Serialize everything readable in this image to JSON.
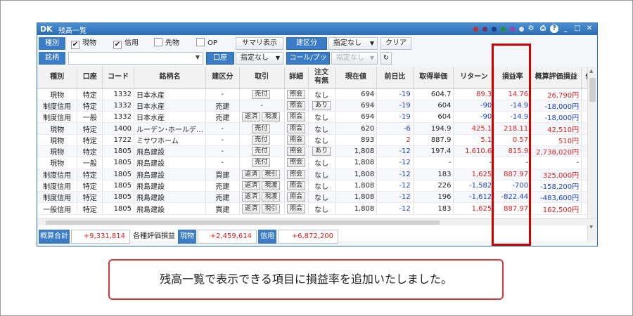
{
  "window": {
    "title": "残高一覧",
    "logo": "DK"
  },
  "colors": {
    "accent": "#3a7cc6",
    "positive": "#e02020",
    "negative": "#1a3fd6",
    "highlight": "#d10000",
    "dots": [
      "#c03030",
      "#7a2c6e",
      "#1f3f8c",
      "#2d8c3a",
      "#9a44aa",
      "#e0e0e0"
    ]
  },
  "toolbar1": {
    "label": "種別",
    "checks": [
      {
        "label": "現物",
        "checked": "✔"
      },
      {
        "label": "信用",
        "checked": "✔"
      },
      {
        "label": "先物",
        "checked": ""
      },
      {
        "label": "OP",
        "checked": ""
      }
    ],
    "summary_btn": "サマリ表示",
    "split_btn": "建区分",
    "select": "指定なし",
    "clear_btn": "クリア"
  },
  "toolbar2": {
    "label": "銘柄",
    "input_value": "",
    "account_btn": "口座",
    "select1": "指定なし",
    "callput_btn": "コール/プット",
    "select2": "指定なし",
    "refresh_icon": "refresh-icon"
  },
  "columns": [
    "種別",
    "口座",
    "コード",
    "銘柄名",
    "建区分",
    "取引",
    "詳細",
    "注文\n有無",
    "現在値",
    "前日比",
    "取得単価",
    "リターン",
    "損益率",
    "概算評価損益",
    "保"
  ],
  "rows": [
    {
      "kind": "現物",
      "acct": "特定",
      "code": "1332",
      "name": "日本水産",
      "split": "-",
      "trade": [
        "売付"
      ],
      "detail": "照会",
      "order": "なし",
      "price": "694",
      "chg": "-19",
      "cost": "604.7",
      "ret": "89.3",
      "rate": "14.76",
      "pl": "26,790円",
      "ret_sign": "pos",
      "rate_sign": "pos",
      "pl_sign": "pos"
    },
    {
      "kind": "制度信用",
      "acct": "特定",
      "code": "1332",
      "name": "日本水産",
      "split": "売建",
      "trade": [],
      "trade_text": "-",
      "detail": "照会",
      "order": "あり",
      "price": "694",
      "chg": "-19",
      "cost": "604",
      "ret": "-90",
      "rate": "-14.9",
      "pl": "-18,000円",
      "ret_sign": "neg",
      "rate_sign": "neg",
      "pl_sign": "neg"
    },
    {
      "kind": "制度信用",
      "acct": "一般",
      "code": "1332",
      "name": "日本水産",
      "split": "売建",
      "trade": [
        "返済",
        "現渡"
      ],
      "detail": "照会",
      "order": "なし",
      "price": "694",
      "chg": "-19",
      "cost": "604",
      "ret": "-90",
      "rate": "-14.9",
      "pl": "-18,000円",
      "ret_sign": "neg",
      "rate_sign": "neg",
      "pl_sign": "neg"
    },
    {
      "kind": "現物",
      "acct": "特定",
      "code": "1400",
      "name": "ルーデン･ホールデ…",
      "split": "-",
      "trade": [
        "売付"
      ],
      "detail": "照会",
      "order": "なし",
      "price": "620",
      "chg": "-6",
      "cost": "194.9",
      "ret": "425.1",
      "rate": "218.11",
      "pl": "42,510円",
      "ret_sign": "pos",
      "rate_sign": "pos",
      "pl_sign": "pos"
    },
    {
      "kind": "現物",
      "acct": "特定",
      "code": "1722",
      "name": "ミサワホーム",
      "split": "-",
      "trade": [
        "売付"
      ],
      "detail": "照会",
      "order": "なし",
      "price": "893",
      "chg": "2",
      "cost": "887.9",
      "ret": "5.1",
      "rate": "0.57",
      "pl": "510円",
      "ret_sign": "pos",
      "rate_sign": "pos",
      "pl_sign": "pos",
      "chg_sign": "pos"
    },
    {
      "kind": "現物",
      "acct": "特定",
      "code": "1805",
      "name": "飛島建設",
      "split": "-",
      "trade": [
        "売付"
      ],
      "detail": "照会",
      "order": "あり",
      "price": "1,808",
      "chg": "-12",
      "cost": "197.4",
      "ret": "1,610.6",
      "rate": "815.9",
      "pl": "2,738,020円",
      "ret_sign": "pos",
      "rate_sign": "pos",
      "pl_sign": "pos"
    },
    {
      "kind": "現物",
      "acct": "一般",
      "code": "1805",
      "name": "飛島建設",
      "split": "-",
      "trade": [
        "売付"
      ],
      "detail": "照会",
      "order": "なし",
      "price": "1,808",
      "chg": "-12",
      "cost": "-",
      "ret": "-",
      "rate": "-",
      "pl": "-",
      "ret_sign": "",
      "rate_sign": "",
      "pl_sign": ""
    },
    {
      "kind": "制度信用",
      "acct": "特定",
      "code": "1805",
      "name": "飛島建設",
      "split": "買建",
      "trade": [
        "返済",
        "現引"
      ],
      "detail": "照会",
      "order": "なし",
      "price": "1,808",
      "chg": "-12",
      "cost": "183",
      "ret": "1,625",
      "rate": "887.97",
      "pl": "325,000円",
      "ret_sign": "pos",
      "rate_sign": "pos",
      "pl_sign": "pos"
    },
    {
      "kind": "制度信用",
      "acct": "特定",
      "code": "1805",
      "name": "飛島建設",
      "split": "売建",
      "trade": [
        "返済",
        "現渡"
      ],
      "detail": "照会",
      "order": "なし",
      "price": "1,808",
      "chg": "-12",
      "cost": "226",
      "ret": "-1,582",
      "rate": "-700",
      "pl": "-158,200円",
      "ret_sign": "neg",
      "rate_sign": "neg",
      "pl_sign": "neg"
    },
    {
      "kind": "制度信用",
      "acct": "特定",
      "code": "1805",
      "name": "飛島建設",
      "split": "売建",
      "trade": [
        "返済",
        "現渡"
      ],
      "detail": "照会",
      "order": "なし",
      "price": "1,808",
      "chg": "-12",
      "cost": "196",
      "ret": "-1,612",
      "rate": "-822.44",
      "pl": "-483,600円",
      "ret_sign": "neg",
      "rate_sign": "neg",
      "pl_sign": "neg"
    },
    {
      "kind": "一般信用",
      "acct": "特定",
      "code": "1805",
      "name": "飛島建設",
      "split": "買建",
      "trade": [
        "返済",
        "現引"
      ],
      "detail": "照会",
      "order": "なし",
      "price": "1,808",
      "chg": "-12",
      "cost": "183",
      "ret": "1,625",
      "rate": "887.97",
      "pl": "162,500円",
      "ret_sign": "pos",
      "rate_sign": "pos",
      "pl_sign": "pos"
    }
  ],
  "footer": {
    "total_label": "概算合計",
    "total_value": "+9,331,814",
    "eval_label": "各種評価損益",
    "cash_label": "現物",
    "cash_value": "+2,459,614",
    "margin_label": "信用",
    "margin_value": "+6,872,200"
  },
  "note": "残高一覧で表示できる項目に損益率を追加いたしました。"
}
